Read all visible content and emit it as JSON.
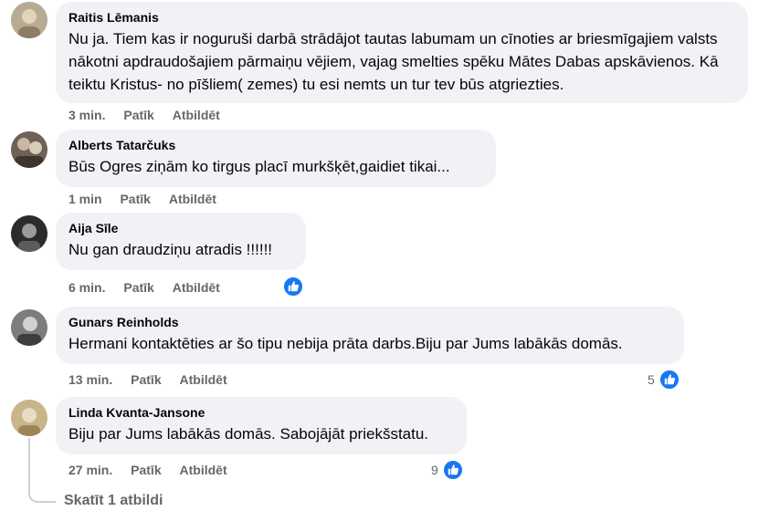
{
  "comments": [
    {
      "author": "Raitis Lēmanis",
      "text": "Nu ja. Tiem kas ir noguruši darbā strādājot tautas labumam un cīnoties ar briesmīgajiem valsts nākotni apdraudošajiem pārmaiņu vējiem, vajag smelties spēku Mātes Dabas apskāvienos. Kā teiktu Kristus- no pīšliem( zemes) tu esi nemts un tur tev būs atgriezties.",
      "time": "3 min.",
      "like_label": "Patīk",
      "reply_label": "Atbildēt",
      "avatar_icon": "avatar-photo-icon"
    },
    {
      "author": "Alberts Tatarčuks",
      "text": "Būs Ogres ziņām ko tirgus placī murkšķēt,gaidiet tikai...",
      "time": "1 min",
      "like_label": "Patīk",
      "reply_label": "Atbildēt",
      "avatar_icon": "avatar-photo-icon"
    },
    {
      "author": "Aija Sīle",
      "text": "Nu gan draudziņu atradis !!!!!!",
      "time": "6 min.",
      "like_label": "Patīk",
      "reply_label": "Atbildēt",
      "reaction_icon": "like-icon",
      "avatar_icon": "avatar-photo-icon"
    },
    {
      "author": "Gunars Reinholds",
      "text": "Hermani kontaktēties ar šo tipu nebija prāta darbs.Biju par Jums labākās domās.",
      "time": "13 min.",
      "like_label": "Patīk",
      "reply_label": "Atbildēt",
      "reaction_count": "5",
      "reaction_icon": "like-icon",
      "avatar_icon": "avatar-photo-icon"
    },
    {
      "author": "Linda Kvanta-Jansone",
      "text": "Biju par Jums labākās domās. Sabojājāt priekšstatu.",
      "time": "27 min.",
      "like_label": "Patīk",
      "reply_label": "Atbildēt",
      "reaction_count": "9",
      "reaction_icon": "like-icon",
      "avatar_icon": "avatar-photo-icon"
    }
  ],
  "view_replies_label": "Skatīt 1 atbildi",
  "colors": {
    "bubble": "#f0f2f5",
    "meta_text": "#65676b",
    "like_blue": "#1877f2",
    "thread_line": "#ced0d4"
  }
}
